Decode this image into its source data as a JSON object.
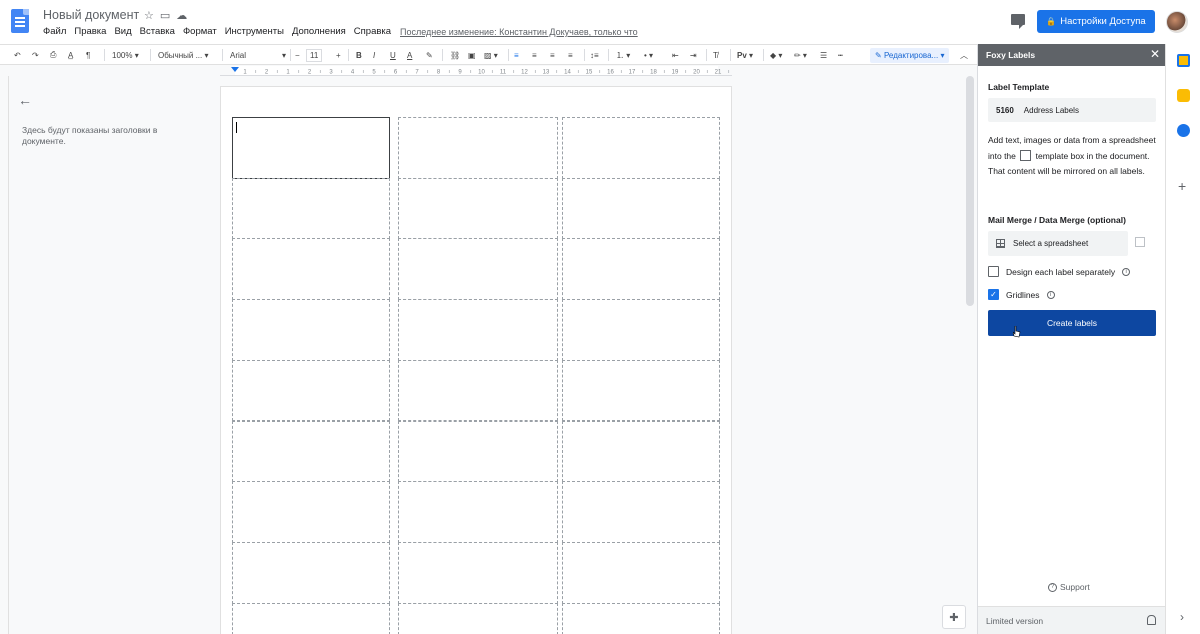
{
  "header": {
    "doc_title": "Новый документ",
    "menu": [
      "Файл",
      "Правка",
      "Вид",
      "Вставка",
      "Формат",
      "Инструменты",
      "Дополнения",
      "Справка"
    ],
    "last_edit": "Последнее изменение: Константин Докучаев, только что",
    "share_label": "Настройки Доступа"
  },
  "toolbar": {
    "zoom": "100%",
    "style": "Обычный ...",
    "font": "Arial",
    "font_size": "11",
    "mode": "Редактирова..."
  },
  "ruler": {
    "ticks": [
      "1",
      "2",
      "1",
      "2",
      "3",
      "4",
      "5",
      "6",
      "7",
      "8",
      "9",
      "10",
      "11",
      "12",
      "13",
      "14",
      "15",
      "16",
      "17",
      "18",
      "19",
      "20",
      "21"
    ]
  },
  "outline": {
    "placeholder": "Здесь будут показаны заголовки в документе."
  },
  "labels": {
    "columns": 3,
    "rows": 9
  },
  "sidebar": {
    "title": "Foxy Labels",
    "template_label": "Label Template",
    "template_code": "5160",
    "template_name": "Address Labels",
    "desc_1": "Add text, images or data from a spreadsheet into the",
    "desc_2": "template box in the document. That content will be mirrored on all labels.",
    "merge_label": "Mail Merge / Data Merge (optional)",
    "select_spreadsheet": "Select a spreadsheet",
    "design_separately": "Design each label separately",
    "gridlines": "Gridlines",
    "create_button": "Create labels",
    "support": "Support",
    "footer": "Limited version"
  }
}
